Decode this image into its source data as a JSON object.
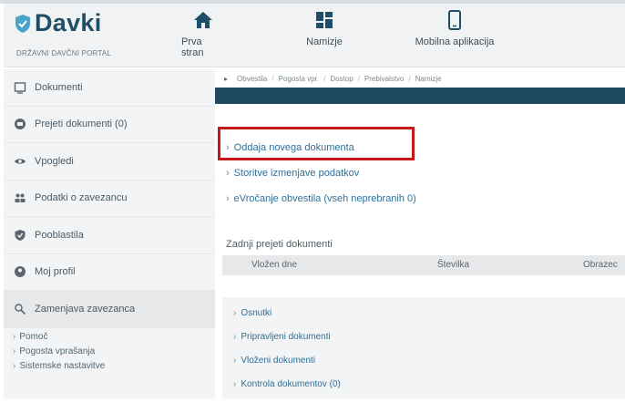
{
  "header": {
    "brand": "Davki",
    "brand_sub": "DRŽAVNI DAVČNI PORTAL",
    "nav": {
      "home": "Prva stran",
      "dashboard": "Namizje",
      "mobile": "Mobilna aplikacija"
    }
  },
  "sidebar": {
    "items": [
      {
        "label": "Dokumenti",
        "icon": "document-icon"
      },
      {
        "label": "Prejeti dokumenti (0)",
        "icon": "inbox-icon"
      },
      {
        "label": "Vpogledi",
        "icon": "eye-icon"
      },
      {
        "label": "Podatki o zavezancu",
        "icon": "people-icon"
      },
      {
        "label": "Pooblastila",
        "icon": "shield-check-icon"
      },
      {
        "label": "Moj profil",
        "icon": "user-circle-icon"
      },
      {
        "label": "Zamenjava zavezanca",
        "icon": "user-switch-icon"
      }
    ],
    "links": [
      "Pomoč",
      "Pogosta vprašanja",
      "Sistemske nastavitve"
    ]
  },
  "breadcrumb": [
    "Obvestila",
    "Pogosta vpr.",
    "Dostop",
    "Prebivalstvo",
    "Namizje"
  ],
  "main": {
    "links": [
      "Oddaja novega dokumenta",
      "Storitve izmenjave podatkov",
      "eVročanje obvestila (vseh neprebranih 0)"
    ],
    "recent": {
      "title": "Zadnji prejeti dokumenti",
      "columns": [
        "Vložen dne",
        "Številka",
        "Obrazec"
      ]
    },
    "accordion": [
      "Osnutki",
      "Pripravljeni dokumenti",
      "Vloženi dokumenti",
      "Kontrola dokumentov (0)"
    ]
  },
  "colors": {
    "brand": "#1f4f66",
    "link": "#2f6f95",
    "highlight": "#c61a1a",
    "breadcrumb_bar": "#1f4a5f"
  }
}
